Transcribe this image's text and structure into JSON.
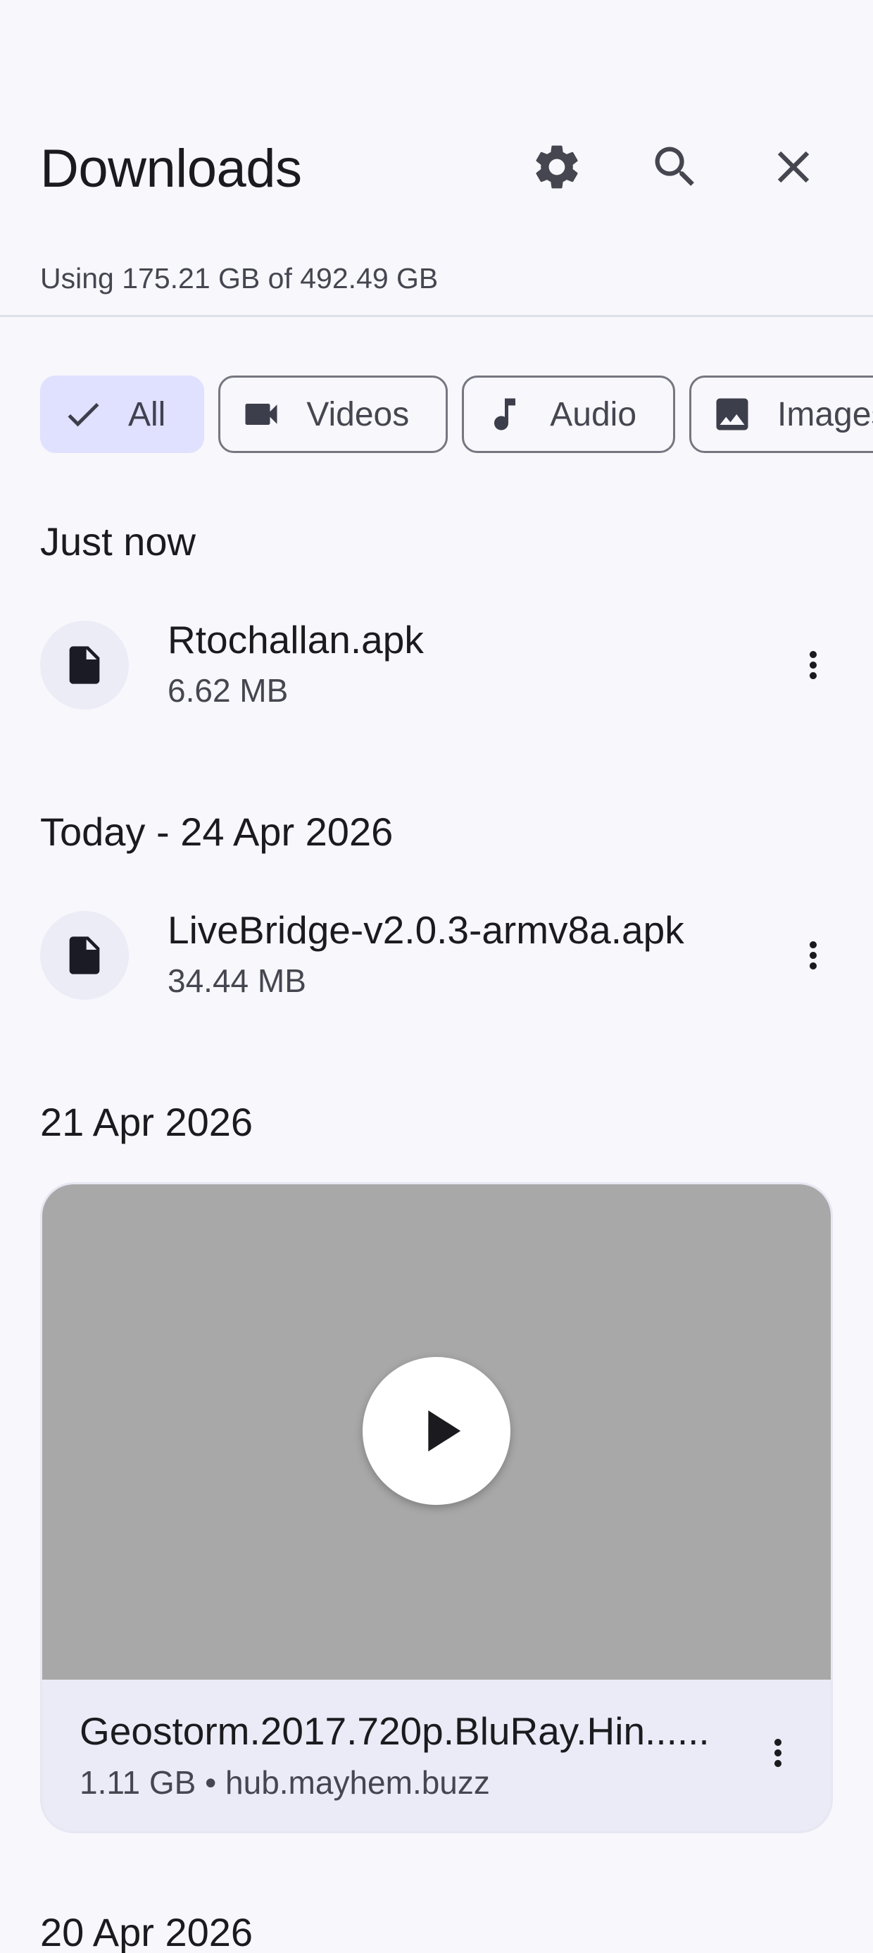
{
  "header": {
    "title": "Downloads",
    "usage": "Using 175.21 GB of 492.49 GB",
    "icons": [
      "settings-icon",
      "search-icon",
      "close-icon"
    ]
  },
  "filters": [
    {
      "label": "All",
      "icon": "check-icon",
      "selected": true
    },
    {
      "label": "Videos",
      "icon": "videocam-icon",
      "selected": false
    },
    {
      "label": "Audio",
      "icon": "music-note-icon",
      "selected": false
    },
    {
      "label": "Images",
      "icon": "image-icon",
      "selected": false
    }
  ],
  "sections": [
    {
      "heading": "Just now",
      "items": [
        {
          "name": "Rtochallan.apk",
          "size": "6.62 MB",
          "icon": "file-icon"
        }
      ]
    },
    {
      "heading": "Today - 24 Apr 2026",
      "items": [
        {
          "name": "LiveBridge-v2.0.3-armv8a.apk",
          "size": "34.44 MB",
          "icon": "file-icon"
        }
      ]
    },
    {
      "heading": "21 Apr 2026",
      "video": {
        "name": "Geostorm.2017.720p.BluRay.Hin......",
        "meta": "1.11 GB • hub.mayhem.buzz",
        "thumbnail_color": "#a8a8a8"
      }
    },
    {
      "heading": "20 Apr 2026"
    }
  ],
  "colors": {
    "background": "#f7f7fc",
    "chip_selected": "#e0e0ff",
    "card": "#eaebf6"
  }
}
